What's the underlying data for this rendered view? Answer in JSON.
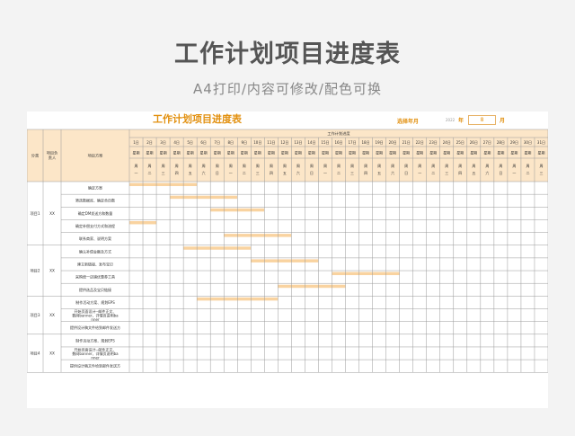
{
  "header": {
    "title": "工作计划项目进度表",
    "subtitle": "A4打印/内容可修改/配色可换"
  },
  "sheet": {
    "title": "工作计划项目进度表",
    "select_label": "选择年月",
    "year_value": "2022",
    "year_suffix": "年",
    "month_value": "8",
    "month_suffix": "月",
    "col_category": "分类",
    "col_owner": "项目负责人",
    "col_plan": "项目方案",
    "col_progress": "工作计划进度",
    "weekday_label": "星期",
    "days": [
      "1日",
      "2日",
      "3日",
      "4日",
      "5日",
      "6日",
      "7日",
      "8日",
      "9日",
      "10日",
      "11日",
      "12日",
      "13日",
      "14日",
      "15日",
      "16日",
      "17日",
      "18日",
      "19日",
      "20日",
      "21日",
      "22日",
      "23日",
      "24日",
      "25日",
      "26日",
      "27日",
      "28日",
      "29日",
      "30日",
      "31日"
    ],
    "weekdays": [
      "周一",
      "周二",
      "周三",
      "周四",
      "周五",
      "周六",
      "周日",
      "周一",
      "周二",
      "周三",
      "周四",
      "周五",
      "周六",
      "周日",
      "周一",
      "周二",
      "周三",
      "周四",
      "周五",
      "周六",
      "周日",
      "周一",
      "周二",
      "周三",
      "周四",
      "周五",
      "周六",
      "周日",
      "周一",
      "周二",
      "周三"
    ],
    "groups": [
      {
        "category": "项目1",
        "owner": "XX",
        "tasks": [
          {
            "name": "确定方案",
            "bar": [
              1,
              5
            ]
          },
          {
            "name": "筛选数据库、确定合页数",
            "bar": [
              4,
              8
            ]
          },
          {
            "name": "确定DM发送方和数量",
            "bar": [
              7,
              10
            ]
          },
          {
            "name": "确定补偿支付方式和流程",
            "bar": [
              1,
              2
            ]
          },
          {
            "name": "联系商家、说明方案",
            "bar": [
              8,
              12
            ]
          }
        ]
      },
      {
        "category": "项目2",
        "owner": "XX",
        "tasks": [
          {
            "name": "确认补偿金额及方式",
            "bar": [
              5,
              9
            ]
          },
          {
            "name": "建立新链接、发布宝贝",
            "bar": [
              10,
              14
            ]
          },
          {
            "name": "采购统一店铺优惠券工具",
            "bar": [
              16,
              20
            ]
          },
          {
            "name": "提供选品及宝贝链接",
            "bar": [
              12,
              16
            ]
          }
        ]
      },
      {
        "category": "项目3",
        "owner": "XX",
        "tasks": [
          {
            "name": "制作活动方案、规划EPS",
            "bar": [
              6,
              11
            ]
          },
          {
            "name": "开始页面设计--邮件正文、数网banner、详情页说明banner",
            "bar": null
          },
          {
            "name": "提供设计稿文件给到邮件发送方",
            "bar": null
          }
        ]
      },
      {
        "category": "项目4",
        "owner": "XX",
        "tasks": [
          {
            "name": "制作活动方案、规划EPS",
            "bar": null
          },
          {
            "name": "开始页面设计--邮件正文、数网banner、详情页说明banner",
            "bar": null
          },
          {
            "name": "提供设计稿文件给到邮件发送方",
            "bar": null
          }
        ]
      }
    ]
  },
  "colors": {
    "header_fill": "#fce6c8",
    "bar_fill": "#f9d3a0",
    "accent": "#e2900f",
    "grid": "#999999"
  }
}
